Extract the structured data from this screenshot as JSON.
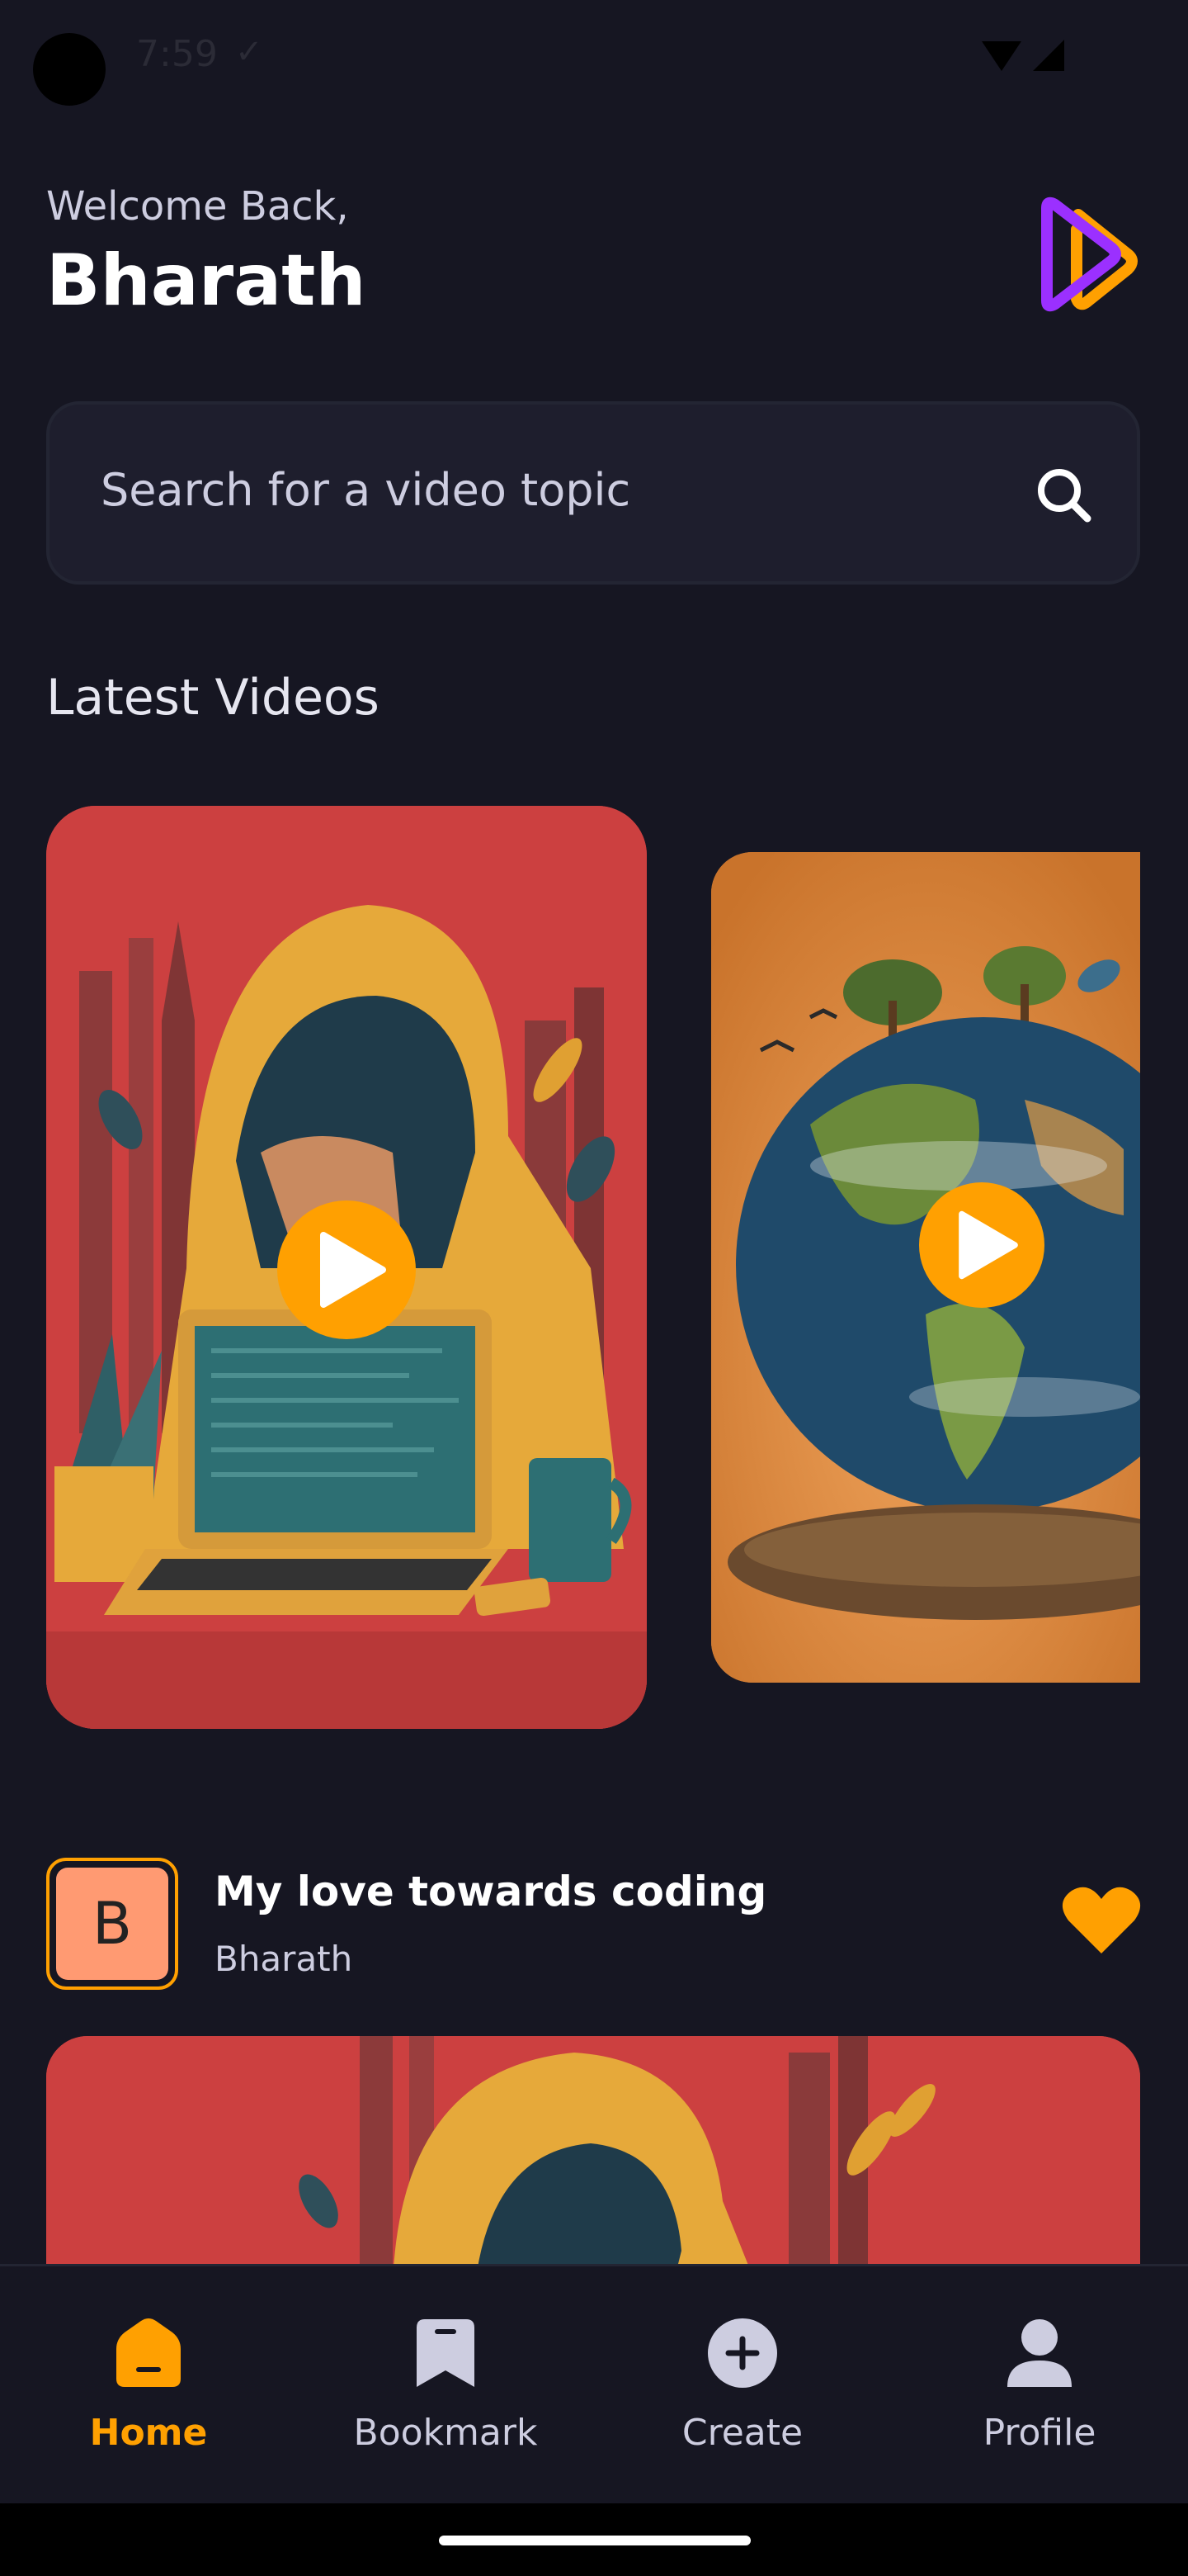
{
  "status_bar": {
    "time": "7:59",
    "check": "✓"
  },
  "header": {
    "welcome": "Welcome Back,",
    "username": "Bharath"
  },
  "search": {
    "placeholder": "Search for a video topic"
  },
  "latest": {
    "title": "Latest Videos"
  },
  "post": {
    "avatar_letter": "B",
    "title": "My love towards coding",
    "author": "Bharath",
    "liked": true
  },
  "tabs": [
    {
      "label": "Home",
      "icon": "home-icon",
      "active": true
    },
    {
      "label": "Bookmark",
      "icon": "bookmark-icon",
      "active": false
    },
    {
      "label": "Create",
      "icon": "plus-icon",
      "active": false
    },
    {
      "label": "Profile",
      "icon": "profile-icon",
      "active": false
    }
  ],
  "colors": {
    "background": "#161622",
    "accent": "#ffa001",
    "surface": "#1e1e2d",
    "muted_text": "#cdcde0",
    "logo_purple": "#9b30ff"
  }
}
